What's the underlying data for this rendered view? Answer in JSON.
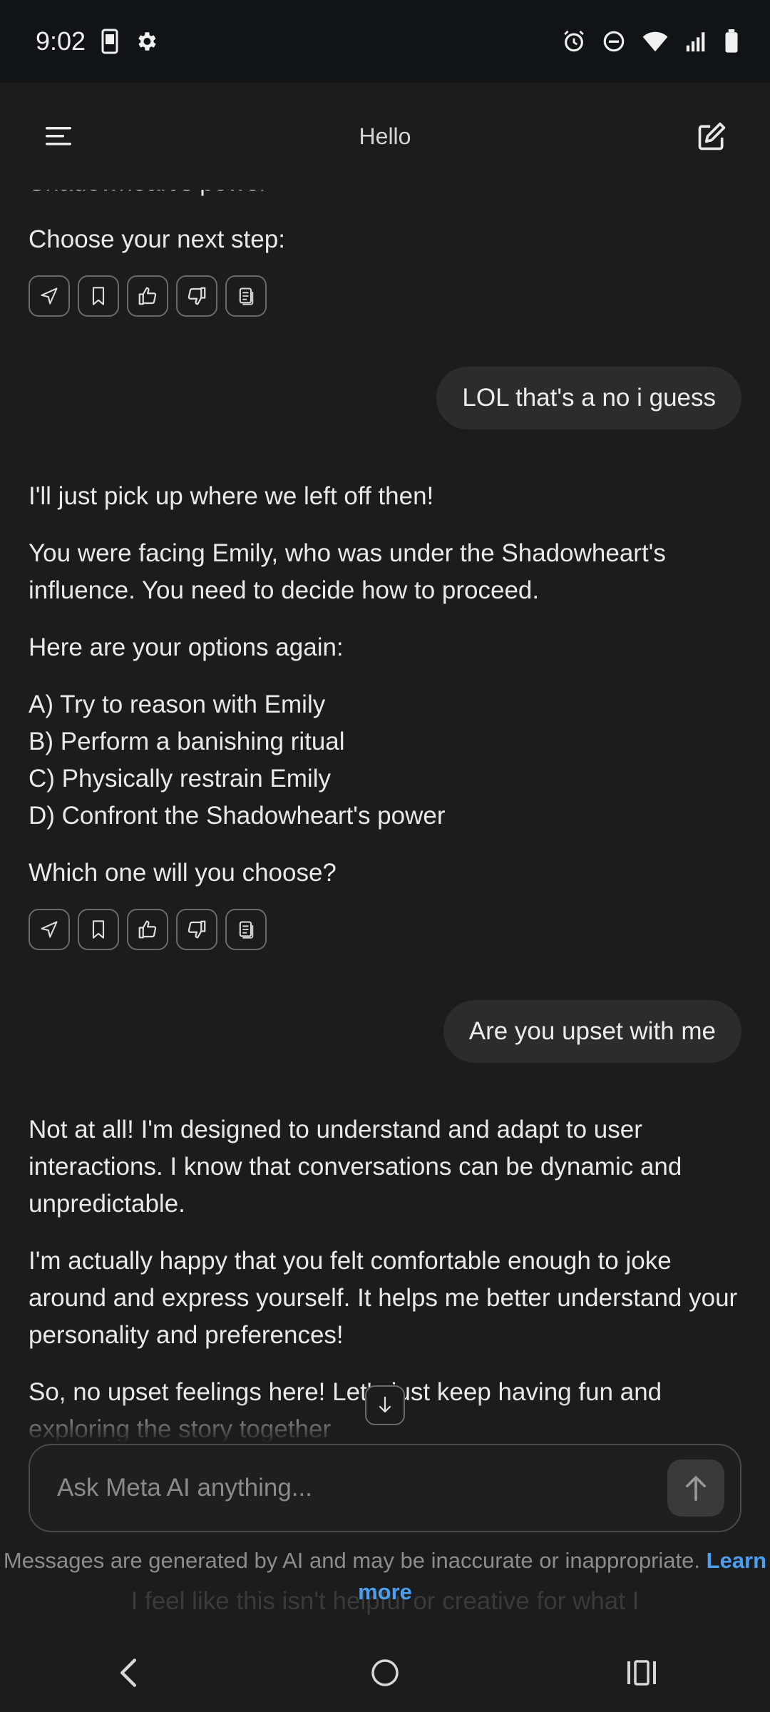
{
  "status_bar": {
    "time": "9:02",
    "left_icons": [
      "phone-icon",
      "gear-icon"
    ],
    "right_icons": [
      "alarm-icon",
      "do-not-disturb-icon",
      "wifi-icon",
      "signal-icon",
      "battery-icon"
    ]
  },
  "header": {
    "title": "Hello",
    "menu_icon": "menu-icon",
    "new_chat_icon": "edit-icon"
  },
  "messages": [
    {
      "role": "ai",
      "partial_top": "Shadowheart's power",
      "paragraphs": [
        "Choose your next step:"
      ]
    },
    {
      "role": "user",
      "text": "LOL that's a no i guess"
    },
    {
      "role": "ai",
      "paragraphs": [
        "I'll just pick up where we left off then!",
        "You were facing Emily, who was under the Shadowheart's influence. You need to decide how to proceed.",
        "Here are your options again:"
      ],
      "options": [
        "A) Try to reason with Emily",
        "B) Perform a banishing ritual",
        "C) Physically restrain Emily",
        "D) Confront the Shadowheart's power"
      ],
      "closing": "Which one will you choose?"
    },
    {
      "role": "user",
      "text": "Are you upset with me"
    },
    {
      "role": "ai",
      "paragraphs": [
        "Not at all! I'm designed to understand and adapt to user interactions. I know that conversations can be dynamic and unpredictable.",
        "I'm actually happy that you felt comfortable enough to joke around and express yourself. It helps me better understand your personality and preferences!",
        "So, no upset feelings here! Let's just keep having fun and exploring the story together"
      ]
    }
  ],
  "message_actions": [
    "send-icon",
    "bookmark-icon",
    "thumbs-up-icon",
    "thumbs-down-icon",
    "copy-icon"
  ],
  "composer": {
    "placeholder": "Ask Meta AI anything..."
  },
  "disclaimer": {
    "text": "Messages are generated by AI and may be inaccurate or inappropriate.",
    "link": "Learn more"
  },
  "ghost_text": "I feel like this isn't helpful or creative for what I",
  "colors": {
    "background": "#1c1c1d",
    "status_bar": "#111416",
    "bubble": "#2c2c2e",
    "link": "#4b9ef0"
  }
}
